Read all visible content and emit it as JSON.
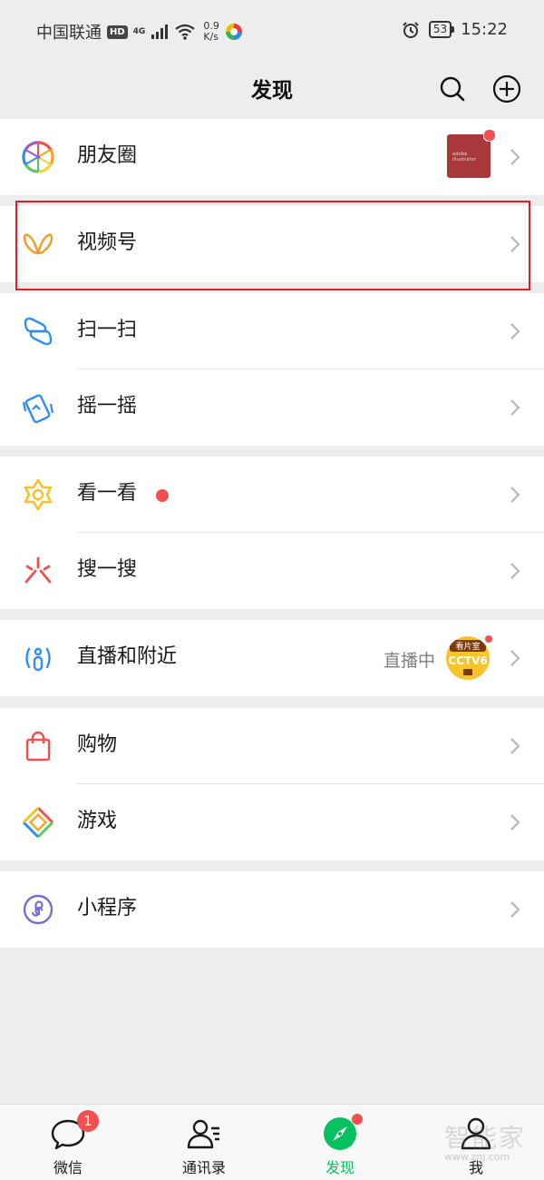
{
  "status_bar": {
    "carrier": "中国联通",
    "hd": "HD",
    "network": "4G",
    "speed_value": "0.9",
    "speed_unit": "K/s",
    "battery": "53",
    "time": "15:22"
  },
  "header": {
    "title": "发现",
    "search_icon": "search-icon",
    "add_icon": "plus-circle-icon"
  },
  "groups": {
    "moments": {
      "label": "朋友圈",
      "thumb_text": "adobe illustrator"
    },
    "channels": {
      "label": "视频号"
    },
    "scan": {
      "label": "扫一扫"
    },
    "shake": {
      "label": "摇一摇"
    },
    "top_stories": {
      "label": "看一看"
    },
    "search": {
      "label": "搜一搜"
    },
    "live": {
      "label": "直播和附近",
      "status": "直播中",
      "thumb_top": "看片室",
      "thumb_main": "CCTV6"
    },
    "shopping": {
      "label": "购物"
    },
    "games": {
      "label": "游戏"
    },
    "mini_programs": {
      "label": "小程序"
    }
  },
  "tabbar": {
    "chats": {
      "label": "微信",
      "badge": "1"
    },
    "contacts": {
      "label": "通讯录"
    },
    "discover": {
      "label": "发现"
    },
    "me": {
      "label": "我"
    }
  },
  "watermark": {
    "line1": "智能家",
    "line2": "www.znj.com"
  },
  "colors": {
    "accent": "#07c160",
    "badge": "#f25050",
    "highlight": "#e02020",
    "background": "#ededed"
  }
}
